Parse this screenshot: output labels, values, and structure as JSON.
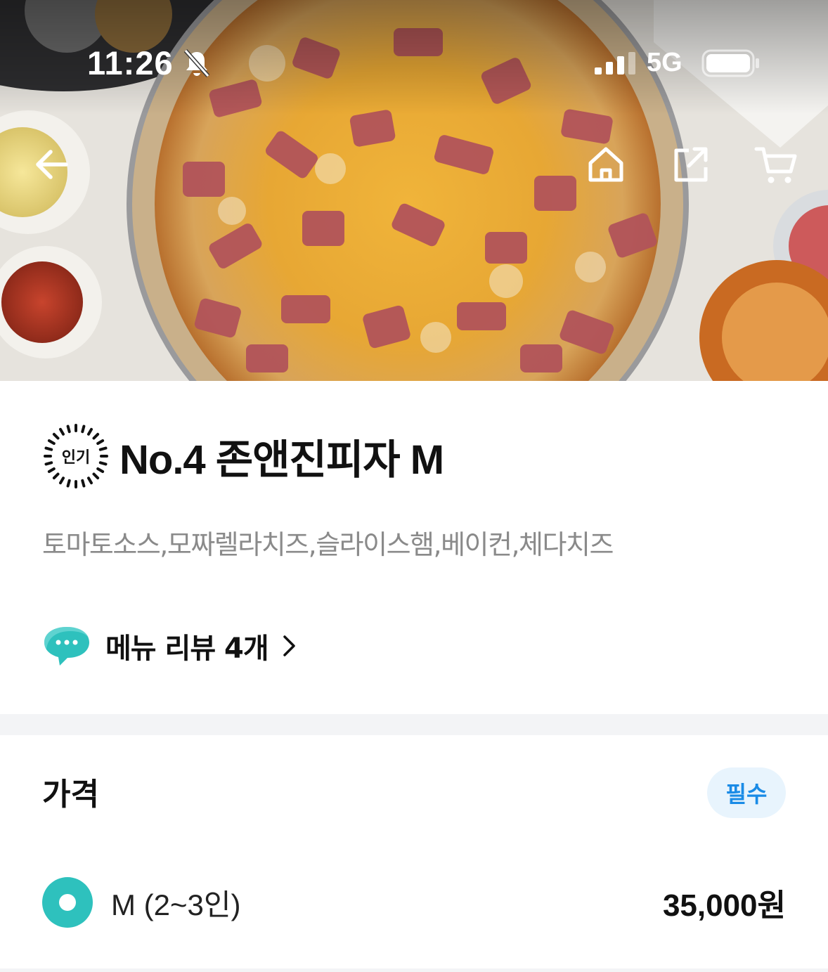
{
  "status_bar": {
    "time": "11:26",
    "network": "5G",
    "icons": [
      "silent-bell-icon",
      "signal-icon",
      "battery-icon"
    ]
  },
  "nav": {
    "icons": [
      "back-arrow-icon",
      "home-icon",
      "share-icon",
      "cart-icon"
    ]
  },
  "menu": {
    "badge": "인기",
    "title": "No.4 존앤진피자 M",
    "description": "토마토소스,모짜렐라치즈,슬라이스햄,베이컨,체다치즈",
    "review_link": "메뉴 리뷰 4개"
  },
  "price_section": {
    "heading": "가격",
    "required_badge": "필수",
    "options": [
      {
        "label": "M (2~3인)",
        "price": "35,000원",
        "selected": true
      }
    ]
  },
  "colors": {
    "accent": "#2ec1bd",
    "required_text": "#1a8be6",
    "required_bg": "#e8f4fd",
    "description": "#8a8a8a"
  }
}
